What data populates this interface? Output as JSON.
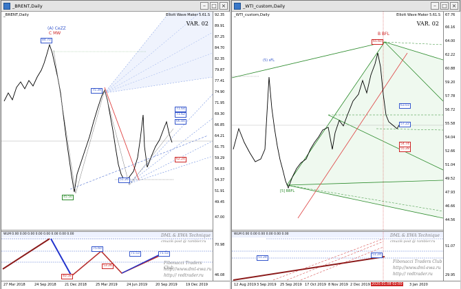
{
  "windows": [
    {
      "title": "_BRENT,Daily",
      "symbol_label": "_BRENT,Daily",
      "tool": "Elliott Wave Maker 5.61.S",
      "var": "VAR. 02",
      "wave_labels": {
        "cezz": "(A) CeZZ",
        "cmw": "C MW"
      },
      "boxes": [
        "84.70",
        "75.39",
        "51.26",
        "45.50",
        "71.64",
        "66.84",
        "62.24",
        "71.62"
      ],
      "price_scale": [
        "92.35",
        "89.91",
        "87.25",
        "84.70",
        "82.35",
        "79.87",
        "77.41",
        "74.90",
        "71.95",
        "69.30",
        "66.85",
        "64.21",
        "61.75",
        "59.29",
        "56.83",
        "54.37",
        "51.91",
        "49.45",
        "47.00",
        "70.98",
        "46.08"
      ],
      "time_axis": [
        "27 Mar 2018",
        "24 Sep 2018",
        "21 Dec 2018",
        "25 Mar 2019",
        "24 Jun 2019",
        "20 Sep 2019",
        "19 Dec 2019"
      ],
      "subchart": {
        "header": "WLM 0.00 0.00 0.00 0.00 0.00 0.00 0.00 0.00",
        "boxes": [
          "75.60",
          "53.26",
          "71.53",
          "71.53",
          "40.58"
        ],
        "watermark": [
          "DML & EWA Technique",
          "cmuzik-post @ rambler.ru",
          "Fibonacci Traders Club",
          "http://www.dml-ewa.ru",
          "http:// redtrader.ru"
        ]
      }
    },
    {
      "title": "_WTI_custom,Daily",
      "symbol_label": "_WTI_custom,Daily",
      "tool": "Elliott Wave Maker 5.61.S",
      "var": "VAR. 02",
      "wave_labels": {
        "bfl": "B BFL",
        "sfl": "(5) sFL",
        "bbfl": "[5] BBFL"
      },
      "boxes": [
        "65.60",
        "63.03",
        "57.22",
        "54.74",
        "55.28"
      ],
      "price_scale": [
        "67.76",
        "66.16",
        "64.00",
        "62.22",
        "60.88",
        "59.20",
        "57.78",
        "56.72",
        "55.58",
        "54.04",
        "52.66",
        "51.04",
        "49.52",
        "47.93",
        "46.66",
        "44.56",
        "51.07",
        "29.95"
      ],
      "time_axis": [
        "12 Aug 2019",
        "3 Sep 2019",
        "25 Sep 2019",
        "17 Oct 2019",
        "8 Nov 2019",
        "2 Dec 2019",
        "2020.01.08 02:00",
        "3 Jan 2020"
      ],
      "subchart": {
        "header": "WLM 0.00 0.00 0.00 0.00 0.00 0.00",
        "boxes": [
          "51.24",
          "51.24"
        ],
        "watermark": [
          "DML & EWA Technique",
          "cmuzik-post @ rambler.ru",
          "Fibonacci Traders Club",
          "http://www.dml-ewa.ru",
          "http:// redtrader.ru"
        ]
      }
    }
  ],
  "colors": {
    "blue": "#3355cc",
    "red": "#cc2222",
    "green": "#2a8a2a",
    "darkred": "#8b1a1a"
  }
}
